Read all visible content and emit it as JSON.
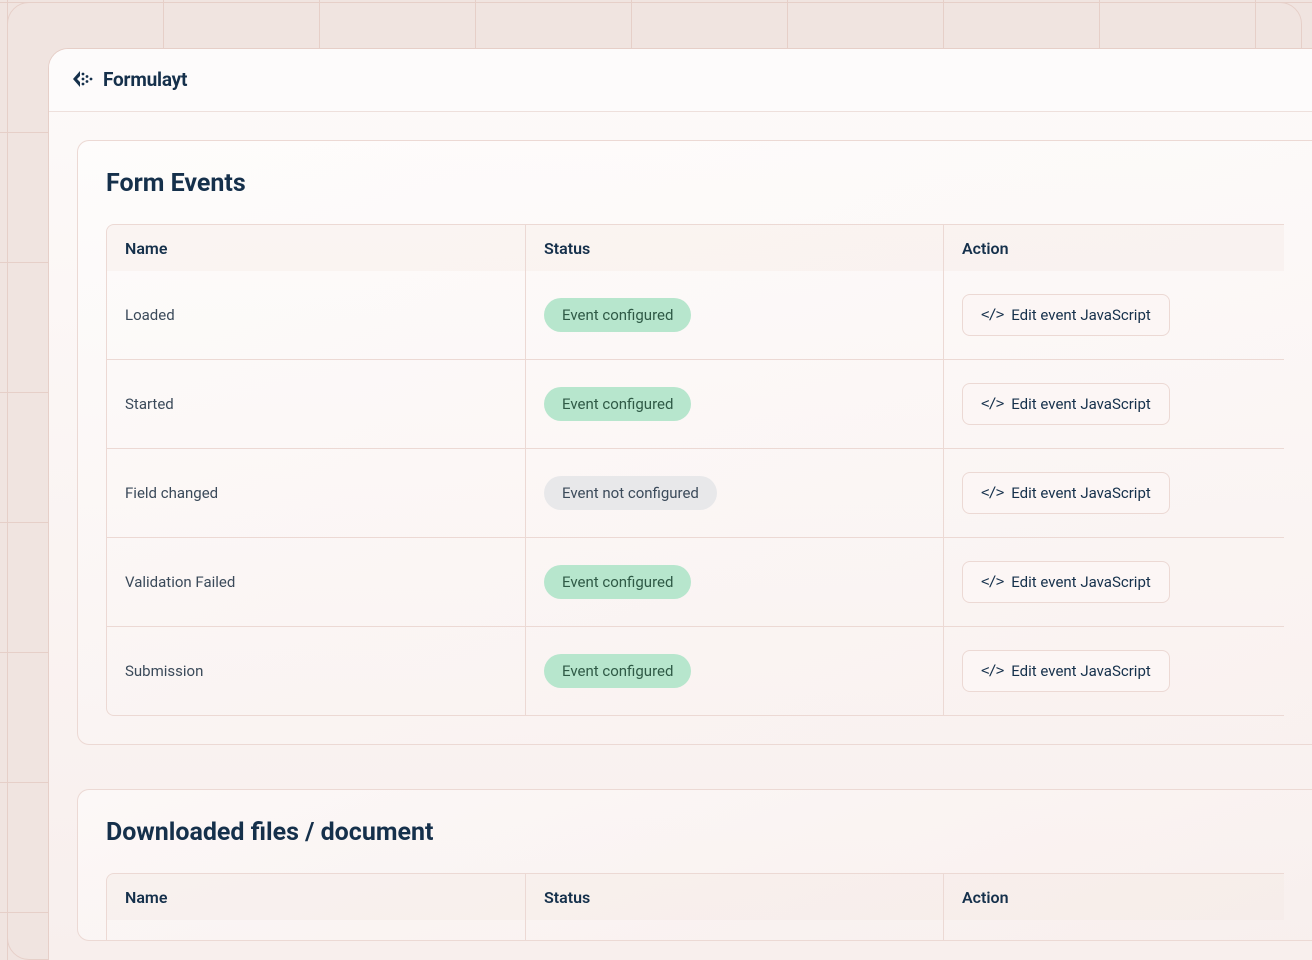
{
  "brand": {
    "name": "Formulayt"
  },
  "panels": {
    "events": {
      "title": "Form Events",
      "columns": {
        "name": "Name",
        "status": "Status",
        "action": "Action"
      },
      "action_label": "Edit event JavaScript",
      "status_labels": {
        "configured": "Event configured",
        "not_configured": "Event not configured"
      },
      "rows": [
        {
          "name": "Loaded",
          "configured": true
        },
        {
          "name": "Started",
          "configured": true
        },
        {
          "name": "Field changed",
          "configured": false
        },
        {
          "name": "Validation Failed",
          "configured": true
        },
        {
          "name": "Submission",
          "configured": true
        }
      ]
    },
    "downloads": {
      "title": "Downloaded files / document",
      "columns": {
        "name": "Name",
        "status": "Status",
        "action": "Action"
      }
    }
  }
}
